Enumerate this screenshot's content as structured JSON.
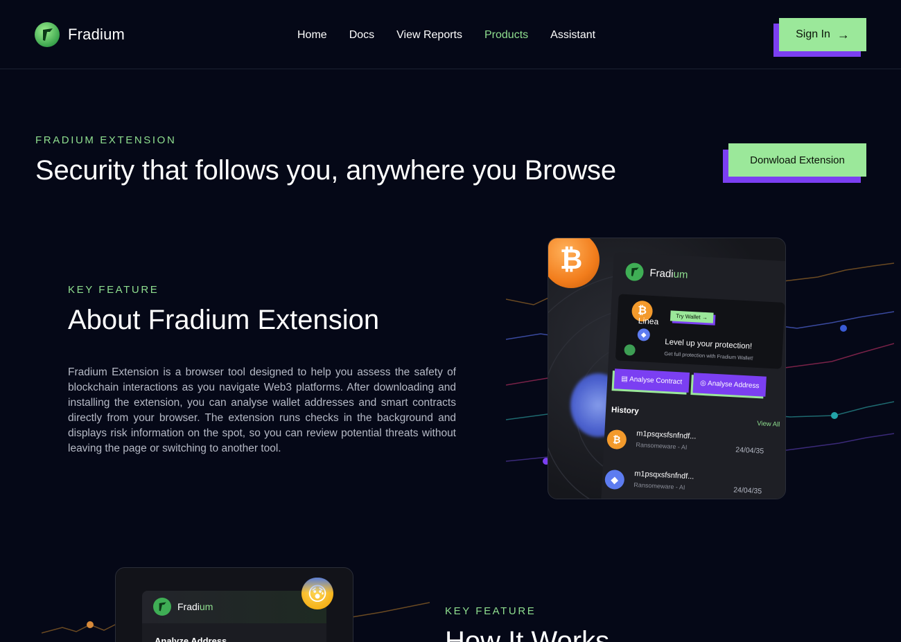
{
  "colors": {
    "background": "#050817",
    "accent_green": "#9be89a",
    "accent_green_text": "#8fdf8f",
    "accent_purple": "#7b3ff2"
  },
  "header": {
    "brand": "Fradium",
    "nav": [
      {
        "label": "Home",
        "active": false
      },
      {
        "label": "Docs",
        "active": false
      },
      {
        "label": "View Reports",
        "active": false
      },
      {
        "label": "Products",
        "active": true
      },
      {
        "label": "Assistant",
        "active": false
      }
    ],
    "signin_label": "Sign In",
    "signin_icon": "arrow-right-icon"
  },
  "hero": {
    "eyebrow": "FRADIUM EXTENSION",
    "title": "Security that follows you, anywhere you Browse",
    "download_label": "Donwload Extension"
  },
  "about": {
    "eyebrow": "KEY FEATURE",
    "title": "About Fradium Extension",
    "body": "Fradium Extension is a browser tool designed to help you assess the safety of blockchain interactions as you navigate Web3 platforms. After downloading and installing the extension, you can analyse wallet addresses and smart contracts directly from your browser. The extension runs checks in the background and displays risk information on the spot, so you can review potential threats without leaving the page or switching to another tool."
  },
  "extension_card": {
    "brand_prefix": "Fradi",
    "brand_suffix": "um",
    "banner_tag": "Linea",
    "try_wallet": "Try Wallet",
    "banner_headline": "Level up your protection!",
    "banner_sub": "Get full protection with Fradium Wallet!",
    "analyse_contract": "Analyse Contract",
    "analyse_address": "Analyse Address",
    "history_title": "History",
    "view_all": "View All",
    "history": [
      {
        "coin": "btc-icon",
        "address": "m1psqxsfsnfndf...",
        "tag": "Ransomeware - AI",
        "date": "24/04/35"
      },
      {
        "coin": "eth-icon",
        "address": "m1psqxsfsnfndf...",
        "tag": "Ransomeware - AI",
        "date": "24/04/35"
      }
    ]
  },
  "how_it_works": {
    "brand_prefix": "Fradi",
    "brand_suffix": "um",
    "panel_label": "Analyze Address",
    "eyebrow": "KEY FEATURE",
    "title": "How It Works"
  }
}
